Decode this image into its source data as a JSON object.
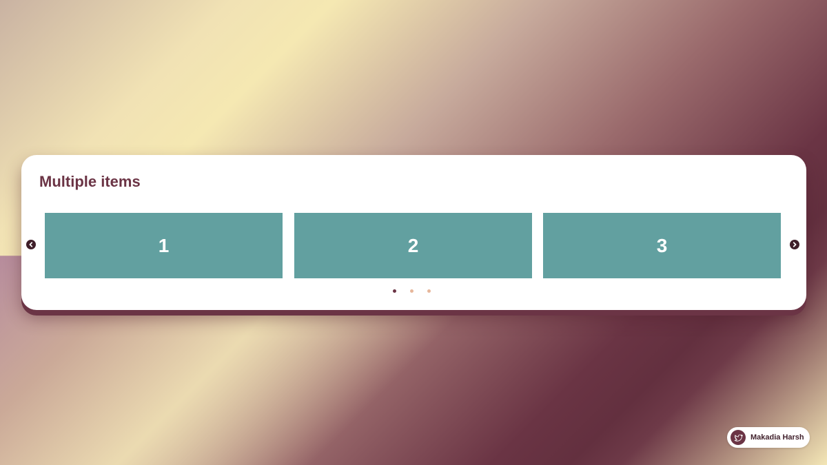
{
  "carousel": {
    "title": "Multiple items",
    "slides": [
      {
        "label": "1"
      },
      {
        "label": "2"
      },
      {
        "label": "3"
      }
    ],
    "prev_icon": "chevron-left-icon",
    "next_icon": "chevron-right-icon",
    "dots_count": 3,
    "active_dot": 0
  },
  "credit": {
    "name": "Makadia Harsh",
    "icon": "twitter-bird-icon"
  },
  "colors": {
    "accent": "#6b3445",
    "slide_bg": "#62a0a0",
    "dot_inactive": "#e7b79b"
  }
}
